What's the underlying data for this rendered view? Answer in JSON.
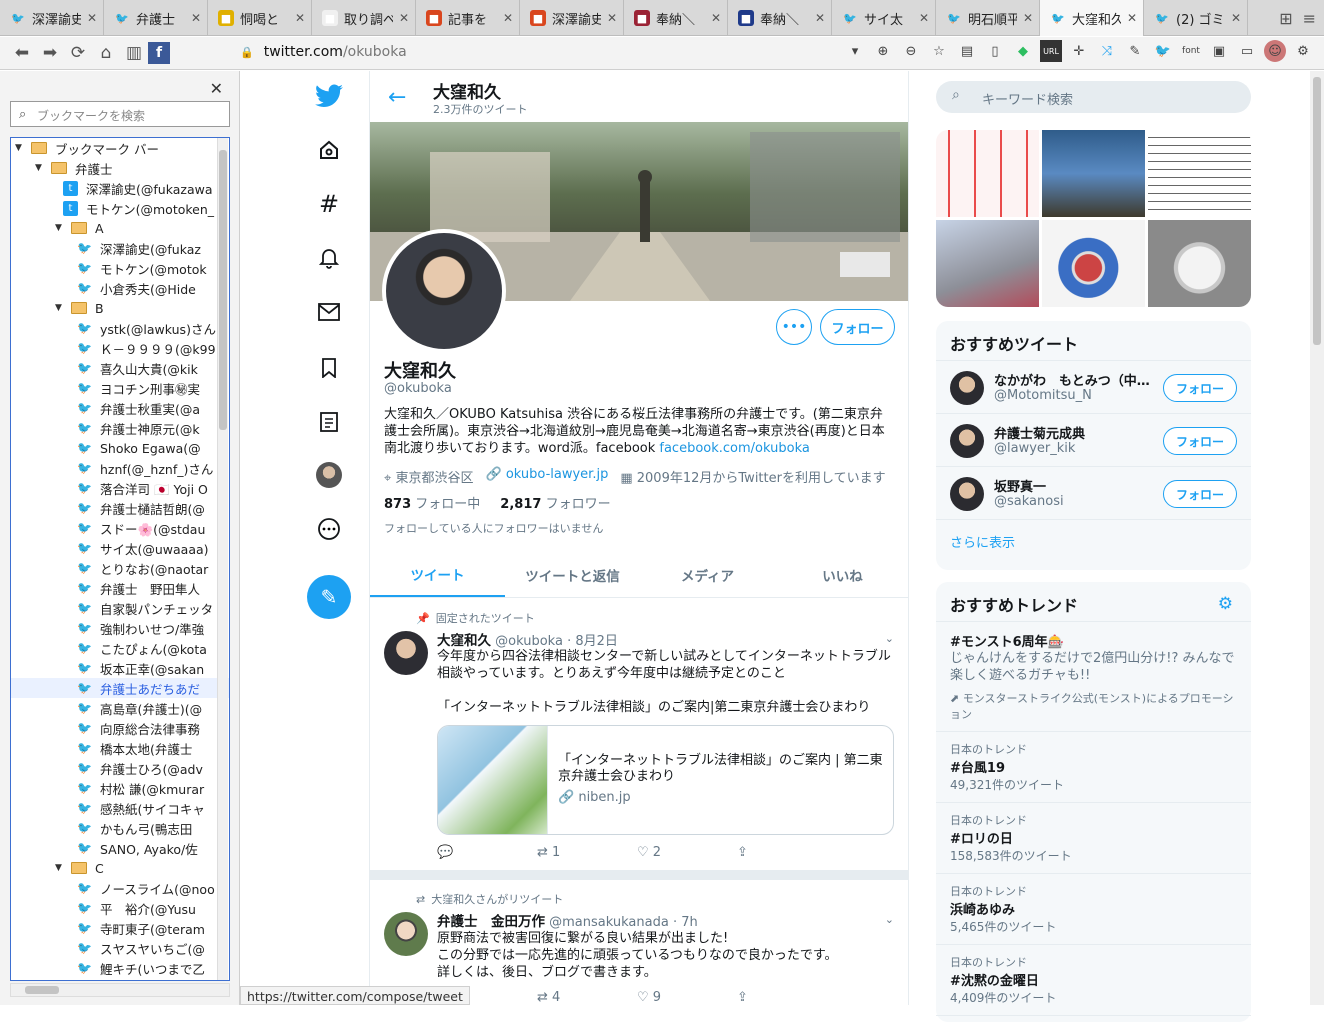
{
  "browser": {
    "tabs": [
      {
        "label": "深澤諭史",
        "fav": "twitter"
      },
      {
        "label": "弁護士",
        "fav": "twitter"
      },
      {
        "label": "恫喝と",
        "fav": "other"
      },
      {
        "label": "取り調べ",
        "fav": "other"
      },
      {
        "label": "記事を",
        "fav": "other"
      },
      {
        "label": "深澤諭史",
        "fav": "other"
      },
      {
        "label": "奉納＼",
        "fav": "other"
      },
      {
        "label": "奉納＼",
        "fav": "other"
      },
      {
        "label": "サイ太",
        "fav": "twitter"
      },
      {
        "label": "明石順平",
        "fav": "twitter"
      },
      {
        "label": "大窪和久",
        "fav": "twitter",
        "active": true
      },
      {
        "label": "(2) ゴミ",
        "fav": "twitter"
      }
    ],
    "url_host": "twitter.com",
    "url_path": "/okuboka",
    "status_url": "https://twitter.com/compose/tweet"
  },
  "sidebar": {
    "search_placeholder": "ブックマークを検索",
    "items": [
      {
        "label": "ブックマーク バー",
        "type": "folder",
        "depth": 0
      },
      {
        "label": "弁護士",
        "type": "folder",
        "depth": 1
      },
      {
        "label": "深澤諭史(@fukazawa",
        "type": "tw2",
        "depth": 2
      },
      {
        "label": "モトケン(@motoken_",
        "type": "tw2",
        "depth": 2
      },
      {
        "label": "A",
        "type": "folder",
        "depth": 2
      },
      {
        "label": "深澤諭史(@fukaz",
        "type": "tw",
        "depth": 3
      },
      {
        "label": "モトケン(@motok",
        "type": "tw",
        "depth": 3
      },
      {
        "label": "小倉秀夫(@Hide",
        "type": "tw",
        "depth": 3
      },
      {
        "label": "B",
        "type": "folder",
        "depth": 2
      },
      {
        "label": "ystk(@lawkus)さん",
        "type": "tw",
        "depth": 3
      },
      {
        "label": "Ｋ－９９９９(@k99",
        "type": "tw",
        "depth": 3
      },
      {
        "label": "喜久山大貴(@kik",
        "type": "tw",
        "depth": 3
      },
      {
        "label": "ヨコチン刑事㊙実",
        "type": "tw",
        "depth": 3
      },
      {
        "label": "弁護士秋重実(@a",
        "type": "tw",
        "depth": 3
      },
      {
        "label": "弁護士神原元(@k",
        "type": "tw",
        "depth": 3
      },
      {
        "label": "Shoko Egawa(@",
        "type": "tw",
        "depth": 3
      },
      {
        "label": "hznf(@_hznf_)さん",
        "type": "tw",
        "depth": 3
      },
      {
        "label": "落合洋司 🇯🇵 Yoji O",
        "type": "tw",
        "depth": 3
      },
      {
        "label": "弁護士樋詰哲朗(@",
        "type": "tw",
        "depth": 3
      },
      {
        "label": "スドー🌸(@stdau",
        "type": "tw",
        "depth": 3
      },
      {
        "label": "サイ太(@uwaaaa)",
        "type": "tw",
        "depth": 3
      },
      {
        "label": "とりなお(@naotar",
        "type": "tw",
        "depth": 3
      },
      {
        "label": "弁護士　野田隼人",
        "type": "tw",
        "depth": 3
      },
      {
        "label": "自家製パンチェッタ",
        "type": "tw",
        "depth": 3
      },
      {
        "label": "強制わいせつ/準強",
        "type": "tw",
        "depth": 3
      },
      {
        "label": "こたぴょん(@kota",
        "type": "tw",
        "depth": 3
      },
      {
        "label": "坂本正幸(@sakan",
        "type": "tw",
        "depth": 3
      },
      {
        "label": "弁護士あだちあだ",
        "type": "tw",
        "depth": 3,
        "selected": true
      },
      {
        "label": "高島章(弁護士)(@",
        "type": "tw",
        "depth": 3
      },
      {
        "label": "向原総合法律事務",
        "type": "tw",
        "depth": 3
      },
      {
        "label": "橋本太地(弁護士",
        "type": "tw",
        "depth": 3
      },
      {
        "label": "弁護士ひろ(@adv",
        "type": "tw",
        "depth": 3
      },
      {
        "label": "村松 謙(@kmurar",
        "type": "tw",
        "depth": 3
      },
      {
        "label": "感熱紙(サイコキャ",
        "type": "tw",
        "depth": 3
      },
      {
        "label": "かもん弓(鴨志田",
        "type": "tw",
        "depth": 3
      },
      {
        "label": "SANO, Ayako/佐",
        "type": "tw",
        "depth": 3
      },
      {
        "label": "C",
        "type": "folder",
        "depth": 2
      },
      {
        "label": "ノースライム(@noo",
        "type": "tw",
        "depth": 3
      },
      {
        "label": "平　裕介(@Yusu",
        "type": "tw",
        "depth": 3
      },
      {
        "label": "寺町東子(@teram",
        "type": "tw",
        "depth": 3
      },
      {
        "label": "スヤスヤいちご(@",
        "type": "tw",
        "depth": 3
      },
      {
        "label": "鯉キチ(いつまで乙",
        "type": "tw",
        "depth": 3
      }
    ]
  },
  "profile": {
    "header_name": "大窪和久",
    "tweet_count": "2.3万件のツイート",
    "name": "大窪和久",
    "handle": "@okuboka",
    "bio": "大窪和久／OKUBO Katsuhisa 渋谷にある桜丘法律事務所の弁護士です。(第二東京弁護士会所属)。東京渋谷→北海道紋別→鹿児島奄美→北海道名寄→東京渋谷(再度)と日本南北渡り歩いております。word派。facebook ",
    "bio_link": "facebook.com/okuboka",
    "location": "東京都渋谷区",
    "website": "okubo-lawyer.jp",
    "joined": "2009年12月からTwitterを利用しています",
    "following_count": "873",
    "following_label": "フォロー中",
    "followers_count": "2,817",
    "followers_label": "フォロワー",
    "no_followers_note": "フォローしている人にフォロワーはいません",
    "follow_button": "フォロー",
    "tabs": [
      "ツイート",
      "ツイートと返信",
      "メディア",
      "いいね"
    ]
  },
  "tweets": [
    {
      "context": "固定されたツイート",
      "name": "大窪和久",
      "handle": "@okuboka",
      "date": "· 8月2日",
      "text1": "今年度から四谷法律相談センターで新しい試みとしてインターネットトラブル相談やっています。とりあえず今年度中は継続予定とのこと",
      "text2": "「インターネットトラブル法律相談」のご案内|第二東京弁護士会ひまわり",
      "card_title": "「インターネットトラブル法律相談」のご案内 | 第二東京弁護士会ひまわり",
      "card_url": "niben.jp",
      "replies": "",
      "retweets": "1",
      "likes": "2"
    },
    {
      "context": "大窪和久さんがリツイート",
      "name": "弁護士　金田万作",
      "handle": "@mansakukanada",
      "date": "· 7h",
      "text1": "原野商法で被害回復に繋がる良い結果が出ました!",
      "text2": "この分野では一応先進的に頑張っているつもりなので良かったです。",
      "text3": "詳しくは、後日、ブログで書きます。",
      "retweets": "4",
      "likes": "9"
    }
  ],
  "right": {
    "search_placeholder": "キーワード検索",
    "rec_title": "おすすめツイート",
    "accounts": [
      {
        "name": "なかがわ　もとみつ（中…",
        "handle": "@Motomitsu_N",
        "button": "フォロー"
      },
      {
        "name": "弁護士菊元成典",
        "handle": "@lawyer_kik",
        "button": "フォロー"
      },
      {
        "name": "坂野真一",
        "handle": "@sakanosi",
        "button": "フォロー"
      }
    ],
    "show_more": "さらに表示",
    "trend_title": "おすすめトレンド",
    "promo_trend": {
      "name": "#モンスト6周年🎰",
      "desc": "じゃんけんをするだけで2億円山分け!? みんなで楽しく遊べるガチャも!!",
      "promo": "モンスターストライク公式(モンスト)によるプロモーション"
    },
    "trends": [
      {
        "cat": "日本のトレンド",
        "name": "#台風19",
        "count": "49,321件のツイート"
      },
      {
        "cat": "日本のトレンド",
        "name": "#ロリの日",
        "count": "158,583件のツイート"
      },
      {
        "cat": "日本のトレンド",
        "name": "浜崎あゆみ",
        "count": "5,465件のツイート"
      },
      {
        "cat": "日本のトレンド",
        "name": "#沈黙の金曜日",
        "count": "4,409件のツイート"
      }
    ]
  },
  "colors": {
    "accent": "#1da1f2",
    "text": "#14171a",
    "muted": "#657786"
  }
}
